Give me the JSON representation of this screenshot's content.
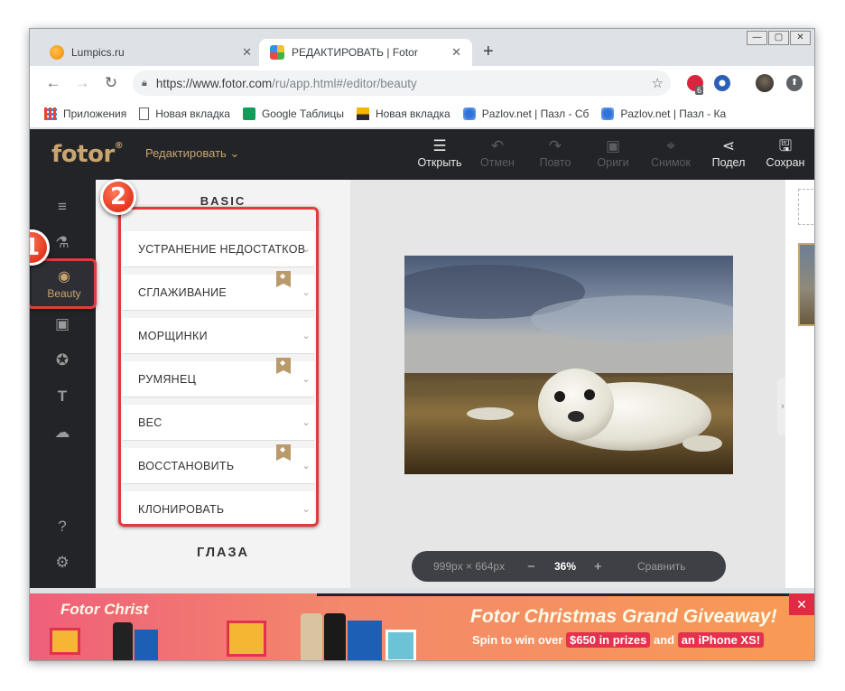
{
  "browser": {
    "tabs": [
      {
        "title": "Lumpics.ru",
        "active": false
      },
      {
        "title": "РЕДАКТИРОВАТЬ | Fotor",
        "active": true
      }
    ],
    "url_host": "https://www.fotor.com",
    "url_path": "/ru/app.html#/editor/beauty",
    "extension_badge": "6",
    "bookmarks": [
      {
        "label": "Приложения",
        "icon": "apps-grid-icon"
      },
      {
        "label": "Новая вкладка",
        "icon": "page-icon"
      },
      {
        "label": "Google Таблицы",
        "icon": "sheets-icon"
      },
      {
        "label": "Новая вкладка",
        "icon": "image-icon"
      },
      {
        "label": "Pazlov.net | Пазл - Сб",
        "icon": "puzzle-icon"
      },
      {
        "label": "Pazlov.net | Пазл - Ка",
        "icon": "puzzle-icon"
      }
    ]
  },
  "app": {
    "logo": "fotor",
    "logo_mark": "®",
    "edit_menu": "Редактировать",
    "header_buttons": [
      {
        "label": "Открыть",
        "icon": "menu-icon",
        "enabled": true
      },
      {
        "label": "Отмен",
        "icon": "undo-icon",
        "enabled": false
      },
      {
        "label": "Повто",
        "icon": "redo-icon",
        "enabled": false
      },
      {
        "label": "Ориги",
        "icon": "original-icon",
        "enabled": false
      },
      {
        "label": "Снимок",
        "icon": "snapshot-icon",
        "enabled": false
      },
      {
        "label": "Подел",
        "icon": "share-icon",
        "enabled": true
      },
      {
        "label": "Сохран",
        "icon": "save-icon",
        "enabled": true
      }
    ],
    "rail_active_label": "Beauty",
    "panel": {
      "section_title": "BASIC",
      "items": [
        {
          "label": "УСТРАНЕНИЕ НЕДОСТАТКОВ",
          "premium": false
        },
        {
          "label": "СГЛАЖИВАНИЕ",
          "premium": true
        },
        {
          "label": "МОРЩИНКИ",
          "premium": false
        },
        {
          "label": "РУМЯНЕЦ",
          "premium": true
        },
        {
          "label": "ВЕС",
          "premium": false
        },
        {
          "label": "ВОССТАНОВИТЬ",
          "premium": true
        },
        {
          "label": "КЛОНИРОВАТЬ",
          "premium": false
        }
      ],
      "footer_title": "ГЛАЗА"
    },
    "zoombar": {
      "dimensions": "999px × 664px",
      "minus": "−",
      "zoom": "36%",
      "plus": "+",
      "compare": "Сравнить"
    }
  },
  "ad": {
    "left_title": "Fotor Christ",
    "title": "Fotor Christmas Grand Giveaway!",
    "sub_prefix": "Spin to win over",
    "sub_amount": "$650 in prizes",
    "sub_and": "and",
    "sub_prize": "an iPhone XS!",
    "close": "✕"
  },
  "annotations": {
    "badge_1": "1",
    "badge_2": "2",
    "color": "#e23b3b"
  }
}
